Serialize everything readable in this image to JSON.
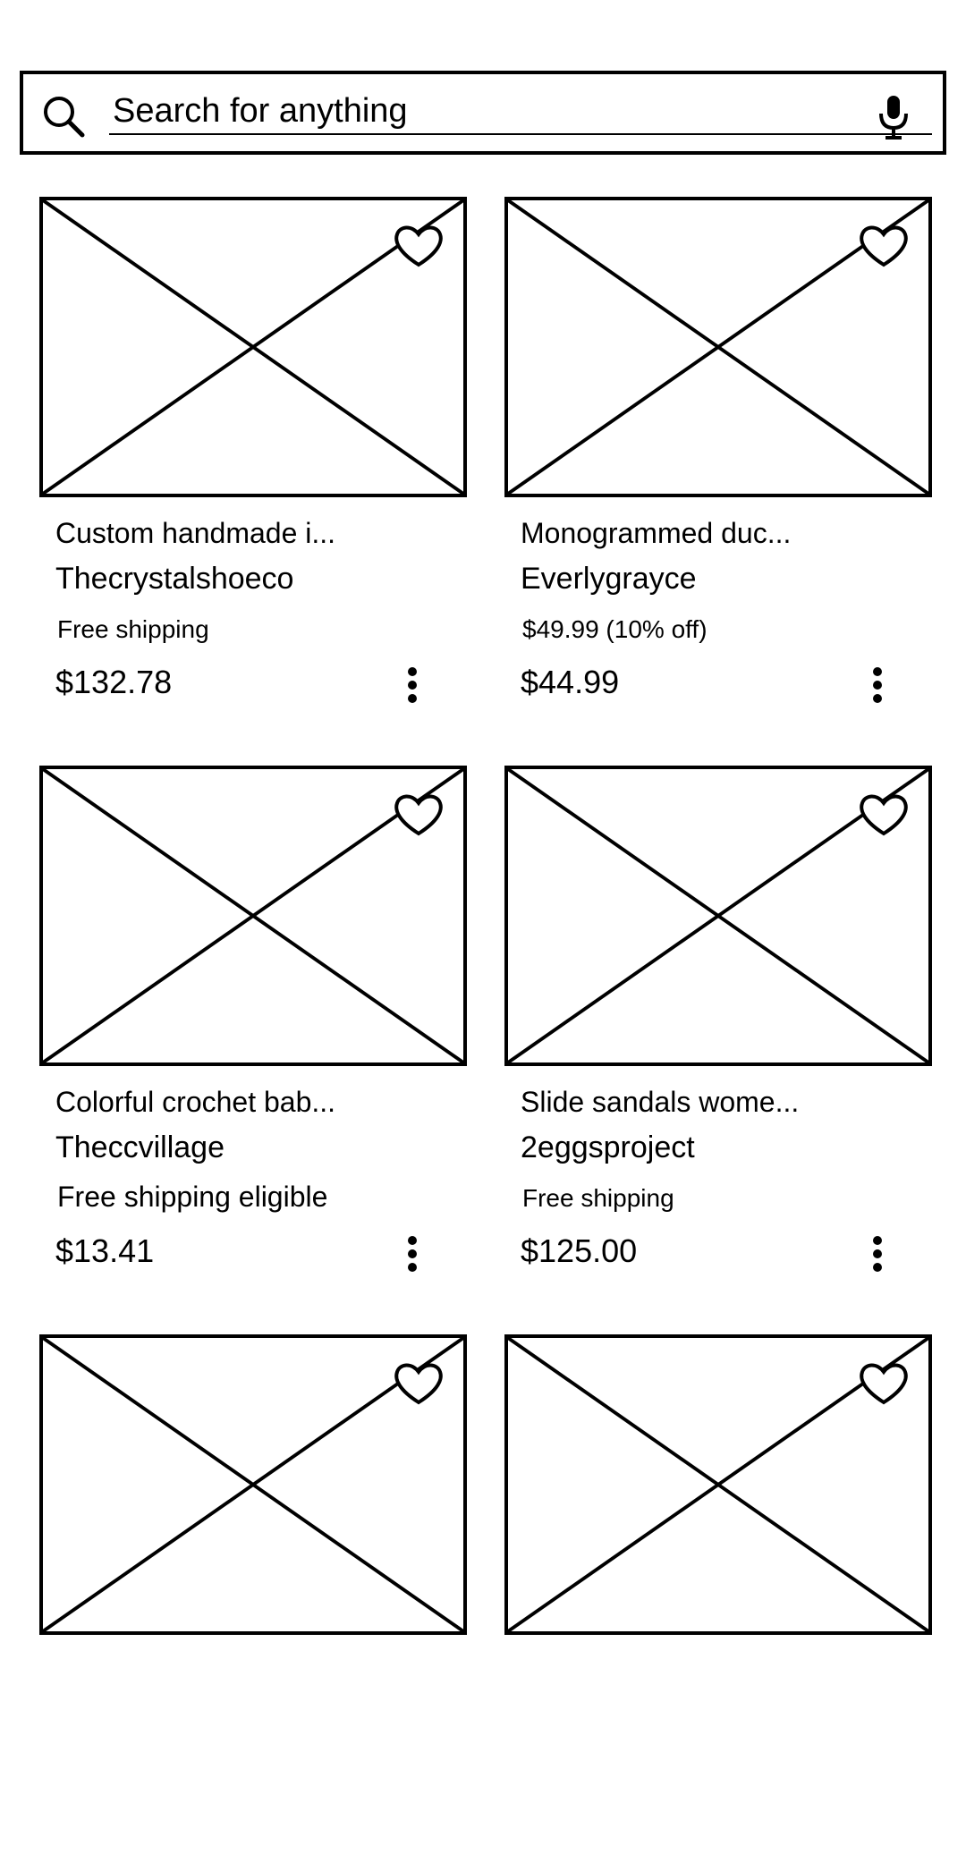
{
  "search": {
    "placeholder": "Search for anything",
    "search_icon": "search-icon",
    "mic_icon": "mic-icon"
  },
  "products": [
    {
      "title": "Custom handmade i...",
      "seller": "Thecrystalshoeco",
      "info": "Free shipping",
      "price": "$132.78"
    },
    {
      "title": "Monogrammed duc...",
      "seller": "Everlygrayce",
      "info": "$49.99 (10% off)",
      "price": "$44.99"
    },
    {
      "title": "Colorful crochet bab...",
      "seller": "Theccvillage",
      "info": "Free shipping eligible",
      "price": "$13.41"
    },
    {
      "title": "Slide sandals wome...",
      "seller": "2eggsproject",
      "info": "Free shipping",
      "price": "$125.00"
    },
    {
      "title": "",
      "seller": "",
      "info": "",
      "price": ""
    },
    {
      "title": "",
      "seller": "",
      "info": "",
      "price": ""
    }
  ],
  "icons": {
    "favorite": "heart-icon",
    "more": "more-vertical-icon",
    "image": "image-placeholder-icon"
  },
  "colors": {
    "ink": "#000000",
    "background": "#ffffff"
  }
}
